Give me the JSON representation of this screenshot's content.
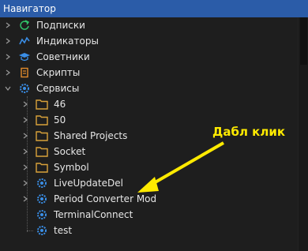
{
  "window": {
    "title": "Навигатор"
  },
  "tree": {
    "subscriptions": "Подписки",
    "indicators": "Индикаторы",
    "experts": "Советники",
    "scripts": "Скрипты",
    "services": "Сервисы",
    "children": {
      "f46": "46",
      "f50": "50",
      "shared": "Shared Projects",
      "socket": "Socket",
      "symbol": "Symbol",
      "liveupdate": "LiveUpdateDel",
      "period": "Period Converter Mod",
      "terminal": "TerminalConnect",
      "test": "test"
    }
  },
  "annotation": {
    "text": "Дабл клик"
  },
  "colors": {
    "titlebar": "#2b5ca8",
    "folder": "#d9a23a",
    "service_icon": "#3a8ee6",
    "arrow": "#ffea00"
  }
}
